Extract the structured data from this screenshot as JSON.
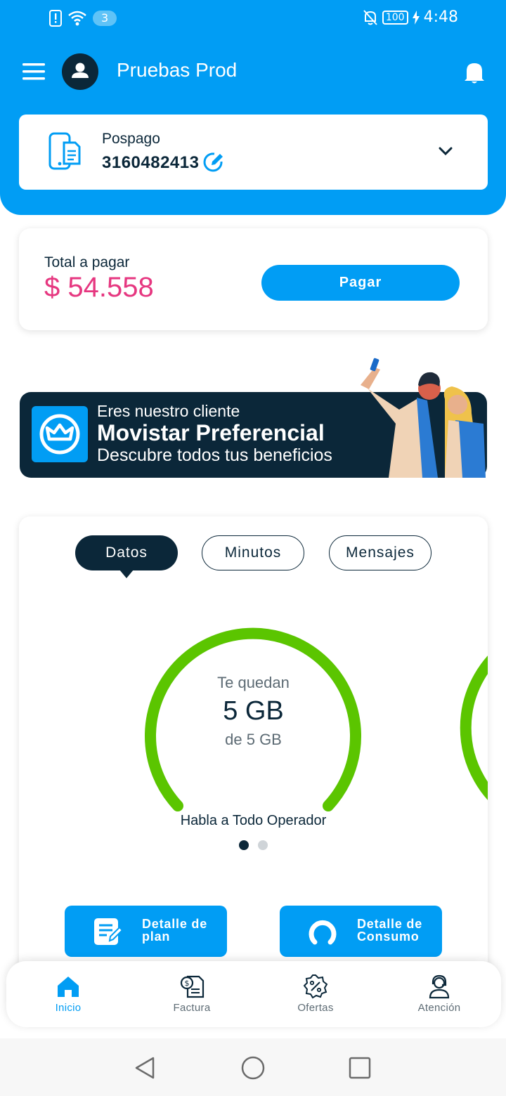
{
  "status_bar": {
    "notification_count": "3",
    "battery": "100",
    "time": "4:48",
    "icons": [
      "alert-icon",
      "wifi-icon",
      "mute-icon",
      "battery-icon",
      "charging-icon"
    ]
  },
  "header": {
    "title": "Pruebas Prod",
    "icons": [
      "menu-icon",
      "avatar-icon",
      "bell-icon"
    ]
  },
  "line_selector": {
    "type": "Pospago",
    "number": "3160482413",
    "icons": [
      "phone-document-icon",
      "edit-icon",
      "chevron-down-icon"
    ]
  },
  "payment": {
    "label": "Total a pagar",
    "amount": "$ 54.558",
    "button": "Pagar"
  },
  "banner": {
    "line1": "Eres nuestro cliente",
    "line2": "Movistar Preferencial",
    "line3": "Descubre todos tus beneficios",
    "icons": [
      "crown-icon",
      "people-selfie-illustration"
    ]
  },
  "consumption": {
    "tabs": [
      {
        "label": "Datos",
        "active": true
      },
      {
        "label": "Minutos",
        "active": false
      },
      {
        "label": "Mensajes",
        "active": false
      }
    ],
    "gauge": {
      "remaining_label": "Te quedan",
      "remaining": "5 GB",
      "total": "de 5 GB",
      "fraction_remaining": 1.0,
      "color": "#5bc500"
    },
    "plan_name": "Habla a Todo Operador",
    "carousel": {
      "pages": 2,
      "active": 0
    },
    "buttons": [
      {
        "label": "Detalle de plan",
        "icon": "document-edit-icon"
      },
      {
        "label": "Detalle de Consumo",
        "icon": "ring-gauge-icon"
      }
    ]
  },
  "bottom_nav": [
    {
      "label": "Inicio",
      "icon": "home-icon",
      "active": true
    },
    {
      "label": "Factura",
      "icon": "invoice-icon",
      "active": false
    },
    {
      "label": "Ofertas",
      "icon": "discount-badge-icon",
      "active": false
    },
    {
      "label": "Atención",
      "icon": "support-agent-icon",
      "active": false
    }
  ],
  "system_nav": [
    "back-icon",
    "home-circle-icon",
    "recents-icon"
  ],
  "colors": {
    "brand_blue": "#019df4",
    "navy": "#0b2739",
    "amount_pink": "#e63780",
    "gauge_green": "#5bc500",
    "gray_text": "#5d6b74"
  }
}
